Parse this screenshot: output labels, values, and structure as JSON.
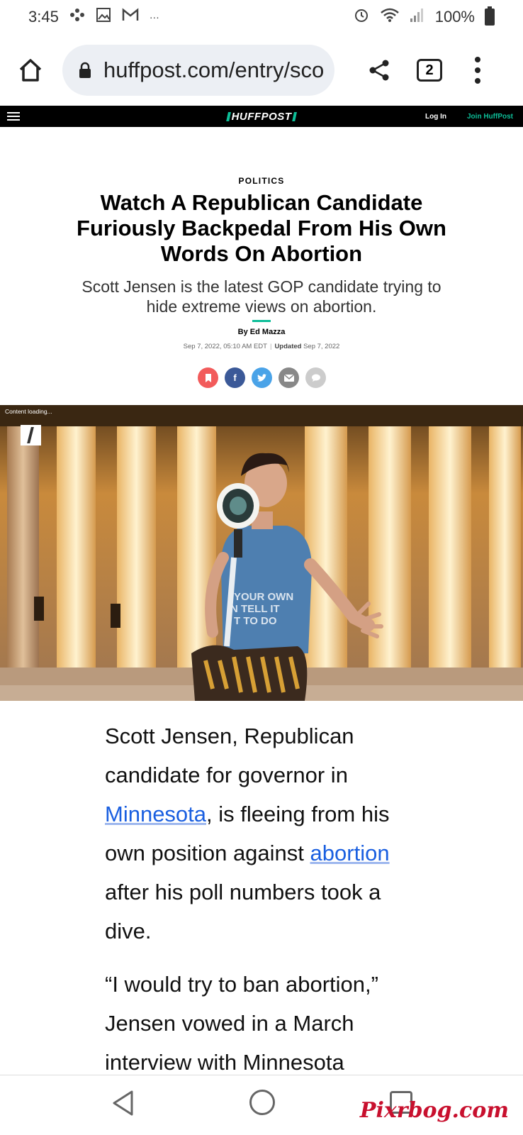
{
  "status_bar": {
    "time": "3:45",
    "more": "···",
    "battery": "100%"
  },
  "browser": {
    "url": "huffpost.com/entry/scott",
    "tab_count": "2"
  },
  "site_header": {
    "logo": "HUFFPOST",
    "login": "Log In",
    "join": "Join HuffPost"
  },
  "article": {
    "section": "POLITICS",
    "headline": "Watch A Republican Candidate Furiously Backpedal From His Own Words On Abortion",
    "subhead": "Scott Jensen is the latest GOP candidate trying to hide extreme views on abortion.",
    "byline_prefix": "By ",
    "author": "Ed Mazza",
    "published": "Sep 7, 2022, 05:10 AM EDT",
    "updated_label": "Updated",
    "updated": "Sep 7, 2022",
    "share_icons": [
      {
        "name": "bookmark",
        "color": "#f25b5b"
      },
      {
        "name": "facebook",
        "color": "#3b5998"
      },
      {
        "name": "twitter",
        "color": "#4aa3e8"
      },
      {
        "name": "email",
        "color": "#888888"
      },
      {
        "name": "comment",
        "color": "#cccccc"
      }
    ],
    "hero": {
      "loading_text": "Content loading...",
      "shirt_text": [
        "YOUR OWN",
        "N TELL IT",
        "T TO DO"
      ]
    },
    "paragraph1": {
      "part1": "Scott Jensen, Republican candidate for governor in ",
      "link1": "Minnesota",
      "part2": ", is fleeing from his own position against ",
      "link2": "abortion",
      "part3": " after his poll numbers took a dive."
    },
    "paragraph2": "“I would try to ban abortion,” Jensen vowed in a March interview with Minnesota"
  },
  "watermark": "Pixrbog.com",
  "colors": {
    "accent": "#0dbe98",
    "link": "#1a5fe0",
    "header_bg": "#000000"
  }
}
